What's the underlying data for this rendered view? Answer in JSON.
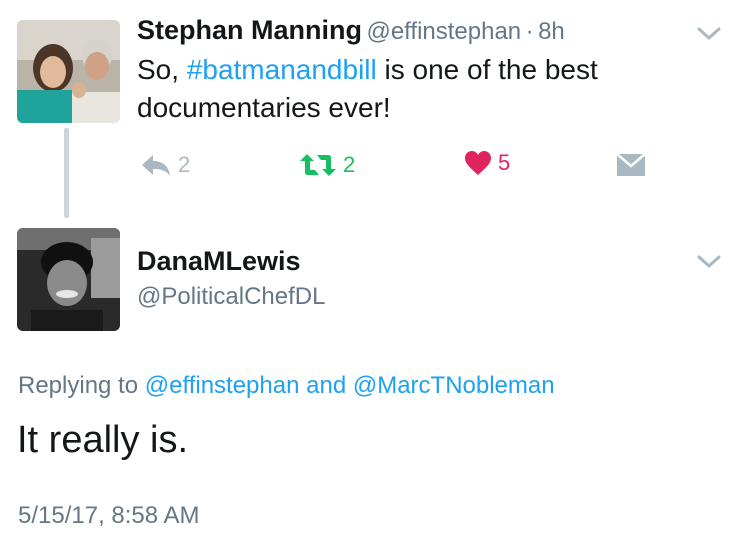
{
  "tweet": {
    "author_name": "Stephan Manning",
    "author_handle": "@effinstephan",
    "separator": "·",
    "time": "8h",
    "text_prefix": "So, ",
    "hashtag": "#batmanandbill",
    "text_rest": " is one of the best",
    "text_line2": "documentaries ever!",
    "reply_count": "2",
    "retweet_count": "2",
    "like_count": "5"
  },
  "reply": {
    "author_name": "DanaMLewis",
    "author_handle": "@PoliticalChefDL",
    "replying_prefix": "Replying to ",
    "mention1": "@effinstephan",
    "and_word": " and ",
    "mention2": "@MarcTNobleman",
    "text": "It really is.",
    "timestamp": "5/15/17, 8:58 AM"
  },
  "colors": {
    "link": "#1da1f2",
    "muted": "#657786",
    "retweet_green": "#17bf63",
    "like_red": "#e0245e",
    "thread_line": "#ccd6dd"
  },
  "icons": {
    "reply": "reply-arrow-icon",
    "retweet": "retweet-icon",
    "like": "heart-icon",
    "dm": "envelope-icon",
    "menu": "chevron-down-icon"
  }
}
